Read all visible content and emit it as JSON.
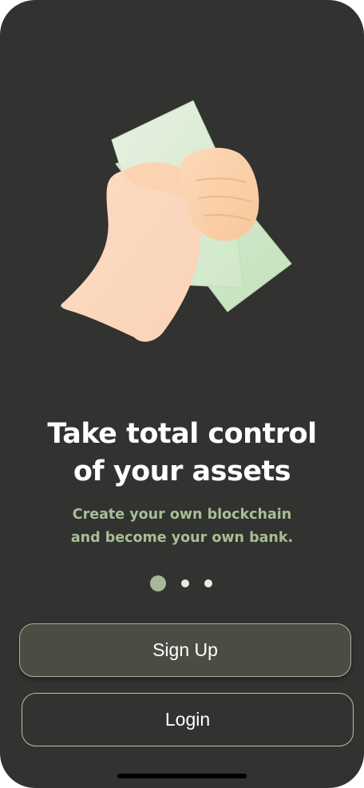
{
  "onboarding": {
    "title_line1": "Take total control",
    "title_line2": "of your assets",
    "subtitle_line1": "Create your own blockchain",
    "subtitle_line2": "and become your own bank.",
    "page_indicator": {
      "count": 3,
      "active_index": 0
    }
  },
  "buttons": {
    "sign_up_label": "Sign Up",
    "login_label": "Login"
  },
  "illustration": {
    "icon": "hand-holding-cash-icon"
  },
  "colors": {
    "background": "#323230",
    "accent": "#a9bd96",
    "primary_button": "#4b4d45",
    "button_border": "#a9b49a"
  }
}
